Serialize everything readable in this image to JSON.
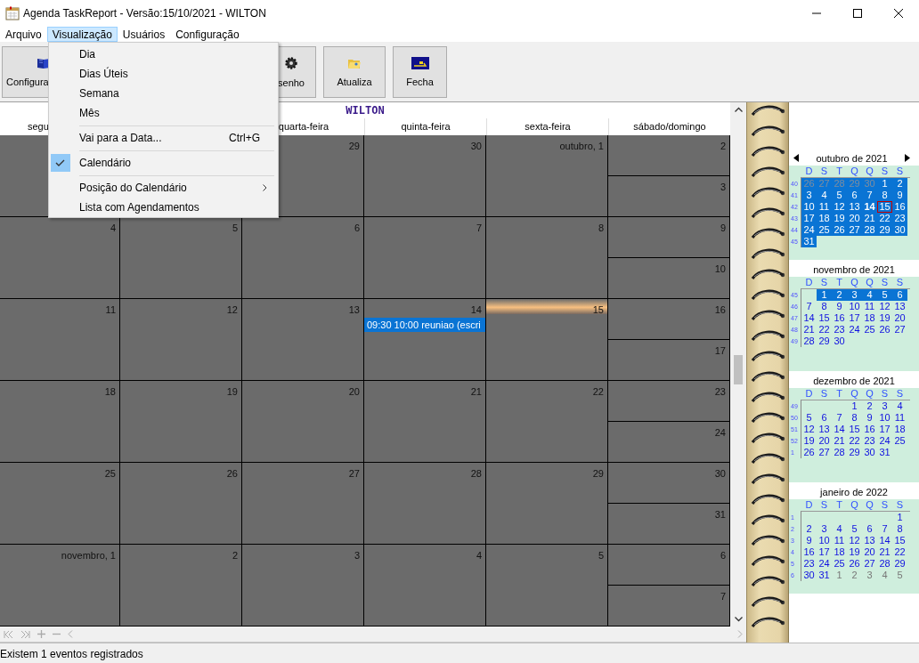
{
  "window": {
    "title": "Agenda TaskReport - Versão:15/10/2021 - WILTON"
  },
  "menu_bar": [
    {
      "label": "Arquivo",
      "selected": false
    },
    {
      "label": "Visualização",
      "selected": true
    },
    {
      "label": "Usuários",
      "selected": false
    },
    {
      "label": "Configuração",
      "selected": false
    }
  ],
  "toolbar": [
    {
      "label": "Configura",
      "kind": "book"
    },
    {
      "label": "senho",
      "kind": "gear"
    },
    {
      "label": "Atualiza",
      "kind": "folder"
    },
    {
      "label": "Fecha",
      "kind": "exit"
    }
  ],
  "menu": [
    {
      "kind": "item",
      "label": "Dia",
      "checked": false,
      "submenu": false
    },
    {
      "kind": "item",
      "label": "Dias Úteis",
      "checked": false,
      "submenu": false
    },
    {
      "kind": "item",
      "label": "Semana",
      "checked": false,
      "submenu": false
    },
    {
      "kind": "item",
      "label": "Mês",
      "checked": false,
      "submenu": false
    },
    {
      "kind": "separator"
    },
    {
      "kind": "item",
      "label": "Vai para a Data...",
      "shortcut": "Ctrl+G",
      "checked": false,
      "submenu": false
    },
    {
      "kind": "separator"
    },
    {
      "kind": "item",
      "label": "Calendário",
      "checked": true,
      "submenu": false
    },
    {
      "kind": "separator"
    },
    {
      "kind": "item",
      "label": "Posição do Calendário",
      "checked": false,
      "submenu": true
    },
    {
      "kind": "item",
      "label": "Lista com Agendamentos",
      "checked": false,
      "submenu": false
    }
  ],
  "calendar": {
    "title": "WILTON",
    "columns": [
      {
        "label": "segu"
      },
      {},
      {
        "label": "quarta-feira"
      },
      {
        "label": "quinta-feira"
      },
      {
        "label": "sexta-feira"
      },
      {
        "label": "sábado/domingo"
      }
    ],
    "weeks": [
      {
        "cells": [
          {},
          {},
          {
            "day": "29",
            "today": false
          },
          {
            "day": "30",
            "today": false
          },
          {
            "day": "outubro, 1",
            "today": false
          }
        ],
        "weekend": [
          "2",
          "3"
        ]
      },
      {
        "cells": [
          {
            "day": "4",
            "today": false
          },
          {
            "day": "5",
            "today": false
          },
          {
            "day": "6",
            "today": false
          },
          {
            "day": "7",
            "today": false
          },
          {
            "day": "8",
            "today": false
          }
        ],
        "weekend": [
          "9",
          "10"
        ]
      },
      {
        "cells": [
          {
            "day": "11",
            "today": false
          },
          {
            "day": "12",
            "today": false
          },
          {
            "day": "13",
            "today": false
          },
          {
            "day": "14",
            "today": false,
            "events": [
              "09:30 10:00 reuniao (escri"
            ]
          },
          {
            "day": "15",
            "today": true
          }
        ],
        "weekend": [
          "16",
          "17"
        ]
      },
      {
        "cells": [
          {
            "day": "18",
            "today": false
          },
          {
            "day": "19",
            "today": false
          },
          {
            "day": "20",
            "today": false
          },
          {
            "day": "21",
            "today": false
          },
          {
            "day": "22",
            "today": false
          }
        ],
        "weekend": [
          "23",
          "24"
        ]
      },
      {
        "cells": [
          {
            "day": "25",
            "today": false
          },
          {
            "day": "26",
            "today": false
          },
          {
            "day": "27",
            "today": false
          },
          {
            "day": "28",
            "today": false
          },
          {
            "day": "29",
            "today": false
          }
        ],
        "weekend": [
          "30",
          "31"
        ]
      },
      {
        "cells": [
          {
            "day": "novembro, 1",
            "today": false
          },
          {
            "day": "2",
            "today": false
          },
          {
            "day": "3",
            "today": false
          },
          {
            "day": "4",
            "today": false
          },
          {
            "day": "5",
            "today": false
          }
        ],
        "weekend": [
          "6",
          "7"
        ]
      }
    ]
  },
  "mini_calendars": [
    {
      "title": "outubro de 2021",
      "navigation": true,
      "weekdays": [
        "D",
        "S",
        "T",
        "Q",
        "Q",
        "S",
        "S"
      ],
      "weeks": [
        {
          "number": "40",
          "selected": true,
          "lead_days": [
            "26",
            "27",
            "28",
            "29",
            "30"
          ],
          "days": [
            "1",
            "2"
          ]
        },
        {
          "number": "41",
          "selected": true,
          "days": [
            "3",
            "4",
            "5",
            "6",
            "7",
            "8",
            "9"
          ]
        },
        {
          "number": "42",
          "selected": true,
          "days": [
            {
              "day": "10",
              "today": false,
              "focused": false
            },
            {
              "day": "11",
              "today": false,
              "focused": false
            },
            {
              "day": "12",
              "today": false,
              "focused": false
            },
            {
              "day": "13",
              "today": false,
              "focused": false
            },
            {
              "day": "14",
              "today": true,
              "focused": false
            },
            {
              "day": "15",
              "today": false,
              "focused": true
            },
            {
              "day": "16",
              "today": false,
              "focused": false
            }
          ]
        },
        {
          "number": "43",
          "selected": true,
          "days": [
            "17",
            "18",
            "19",
            "20",
            "21",
            "22",
            "23"
          ]
        },
        {
          "number": "44",
          "selected": true,
          "days": [
            "24",
            "25",
            "26",
            "27",
            "28",
            "29",
            "30"
          ]
        },
        {
          "number": "45",
          "selected": true,
          "days": [
            "31"
          ]
        }
      ]
    },
    {
      "title": "novembro de 2021",
      "navigation": false,
      "weekdays": [
        "D",
        "S",
        "T",
        "Q",
        "Q",
        "S",
        "S"
      ],
      "weeks": [
        {
          "number": "45",
          "selected": true,
          "days": [
            "1",
            "2",
            "3",
            "4",
            "5",
            "6"
          ]
        },
        {
          "number": "46",
          "selected": false,
          "days": [
            "7",
            "8",
            "9",
            "10",
            "11",
            "12",
            "13"
          ]
        },
        {
          "number": "47",
          "selected": false,
          "days": [
            "14",
            "15",
            "16",
            "17",
            "18",
            "19",
            "20"
          ]
        },
        {
          "number": "48",
          "selected": false,
          "days": [
            "21",
            "22",
            "23",
            "24",
            "25",
            "26",
            "27"
          ]
        },
        {
          "number": "49",
          "selected": false,
          "days": [
            "28",
            "29",
            "30"
          ]
        }
      ]
    },
    {
      "title": "dezembro de 2021",
      "navigation": false,
      "weekdays": [
        "D",
        "S",
        "T",
        "Q",
        "Q",
        "S",
        "S"
      ],
      "weeks": [
        {
          "number": "49",
          "selected": false,
          "days": [
            "1",
            "2",
            "3",
            "4"
          ]
        },
        {
          "number": "50",
          "selected": false,
          "days": [
            "5",
            "6",
            "7",
            "8",
            "9",
            "10",
            "11"
          ]
        },
        {
          "number": "51",
          "selected": false,
          "days": [
            "12",
            "13",
            "14",
            "15",
            "16",
            "17",
            "18"
          ]
        },
        {
          "number": "52",
          "selected": false,
          "days": [
            "19",
            "20",
            "21",
            "22",
            "23",
            "24",
            "25"
          ]
        },
        {
          "number": "1",
          "selected": false,
          "days": [
            "26",
            "27",
            "28",
            "29",
            "30",
            "31"
          ]
        }
      ]
    },
    {
      "title": "janeiro de 2022",
      "navigation": false,
      "weekdays": [
        "D",
        "S",
        "T",
        "Q",
        "Q",
        "S",
        "S"
      ],
      "weeks": [
        {
          "number": "1",
          "selected": false,
          "days": [
            "1"
          ]
        },
        {
          "number": "2",
          "selected": false,
          "days": [
            "2",
            "3",
            "4",
            "5",
            "6",
            "7",
            "8"
          ]
        },
        {
          "number": "3",
          "selected": false,
          "days": [
            "9",
            "10",
            "11",
            "12",
            "13",
            "14",
            "15"
          ]
        },
        {
          "number": "4",
          "selected": false,
          "days": [
            "16",
            "17",
            "18",
            "19",
            "20",
            "21",
            "22"
          ]
        },
        {
          "number": "5",
          "selected": false,
          "days": [
            "23",
            "24",
            "25",
            "26",
            "27",
            "28",
            "29"
          ]
        },
        {
          "number": "6",
          "selected": false,
          "days": [
            "30",
            "31"
          ],
          "trail_days": [
            "1",
            "2",
            "3",
            "4",
            "5"
          ]
        }
      ]
    }
  ],
  "status_bar": "Existem 1 eventos registrados"
}
